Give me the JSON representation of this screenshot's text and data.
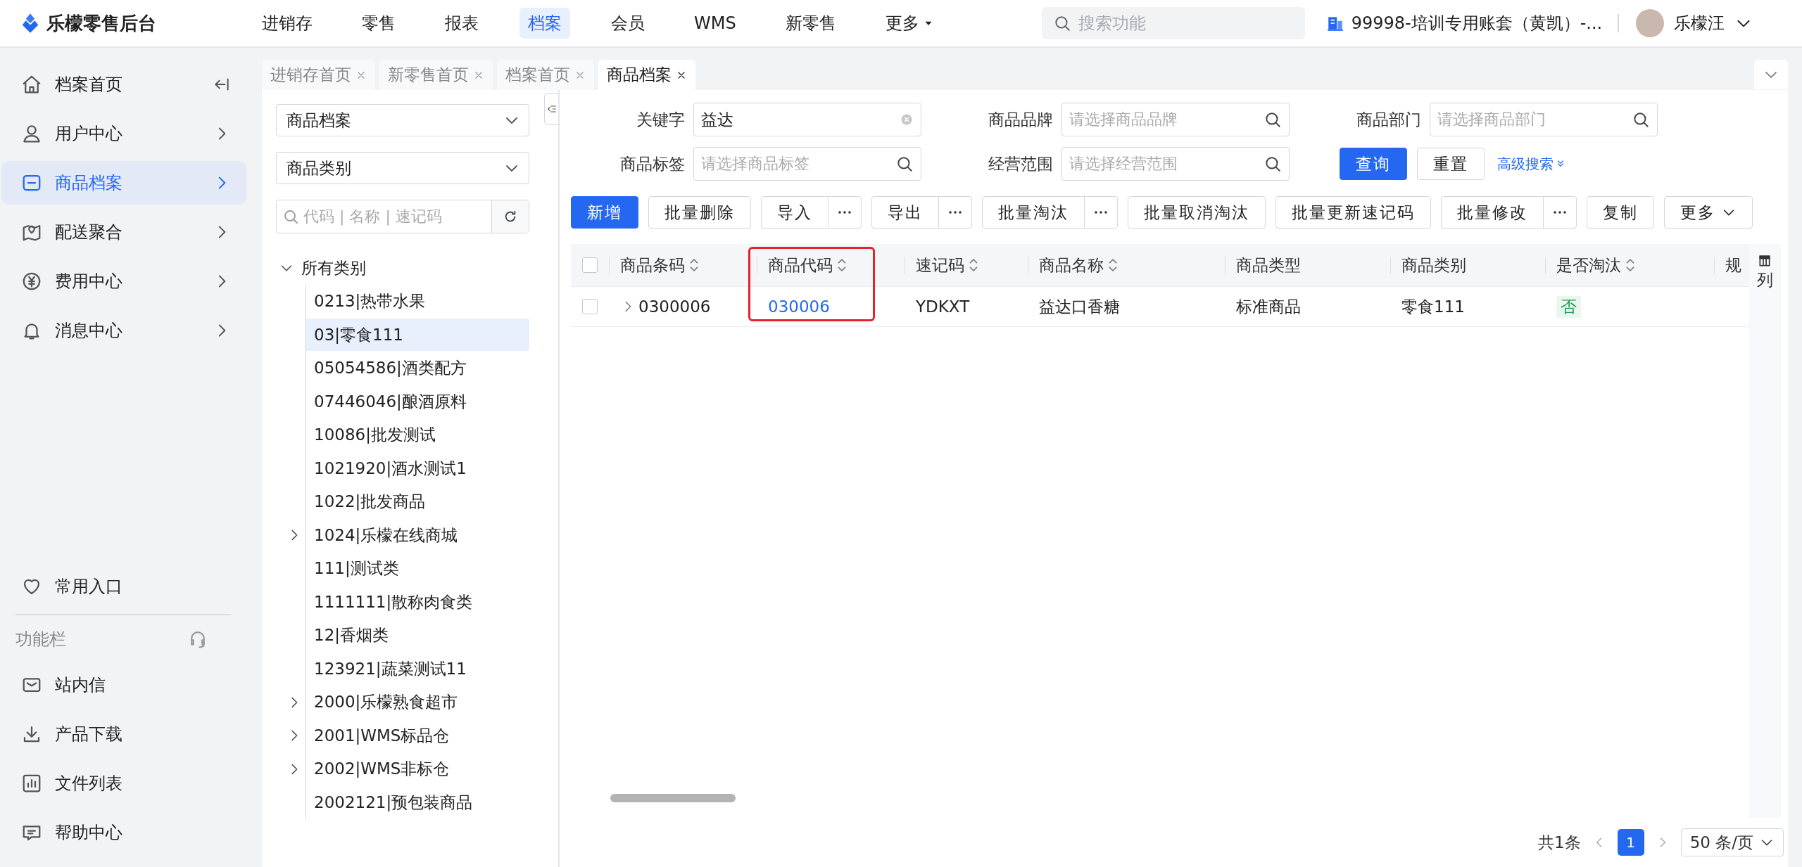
{
  "app": {
    "logo": "乐檬零售后台"
  },
  "nav": [
    {
      "label": "进销存",
      "selected": false
    },
    {
      "label": "零售",
      "selected": false
    },
    {
      "label": "报表",
      "selected": false
    },
    {
      "label": "档案",
      "selected": true
    },
    {
      "label": "会员",
      "selected": false
    },
    {
      "label": "WMS",
      "selected": false
    },
    {
      "label": "新零售",
      "selected": false
    },
    {
      "label": "更多",
      "selected": false
    }
  ],
  "search": {
    "placeholder": "搜索功能"
  },
  "account": "99998-培训专用账套（黄凯）-...",
  "user": "乐檬汪",
  "sidebar": {
    "home": "档案首页",
    "items": [
      {
        "label": "用户中心",
        "selected": false
      },
      {
        "label": "商品档案",
        "selected": true
      },
      {
        "label": "配送聚合",
        "selected": false
      },
      {
        "label": "费用中心",
        "selected": false
      },
      {
        "label": "消息中心",
        "selected": false
      }
    ],
    "favorites": "常用入口",
    "section": "功能栏",
    "tools": [
      "站内信",
      "产品下载",
      "文件列表",
      "帮助中心"
    ]
  },
  "tabs": [
    {
      "label": "进销存首页",
      "selected": false
    },
    {
      "label": "新零售首页",
      "selected": false
    },
    {
      "label": "档案首页",
      "selected": false
    },
    {
      "label": "商品档案",
      "selected": true
    }
  ],
  "category_panel": {
    "selects": [
      "商品档案",
      "商品类别"
    ],
    "search_placeholder": "代码 | 名称 | 速记码",
    "tree": {
      "label": "所有类别",
      "expanded": true,
      "children": [
        {
          "label": "0213|热带水果",
          "kind": "leaf",
          "selected": false
        },
        {
          "label": "03|零食111",
          "kind": "leaf",
          "selected": true
        },
        {
          "label": "05054586|酒类配方",
          "kind": "leaf",
          "selected": false
        },
        {
          "label": "07446046|酿酒原料",
          "kind": "leaf",
          "selected": false
        },
        {
          "label": "10086|批发测试",
          "kind": "leaf",
          "selected": false
        },
        {
          "label": "1021920|酒水测试1",
          "kind": "leaf",
          "selected": false
        },
        {
          "label": "1022|批发商品",
          "kind": "leaf",
          "selected": false
        },
        {
          "label": "1024|乐檬在线商城",
          "kind": "branch",
          "expanded": false,
          "selected": false
        },
        {
          "label": "111|测试类",
          "kind": "leaf",
          "selected": false
        },
        {
          "label": "1111111|散称肉食类",
          "kind": "leaf",
          "selected": false
        },
        {
          "label": "12|香烟类",
          "kind": "leaf",
          "selected": false
        },
        {
          "label": "123921|蔬菜测试11",
          "kind": "leaf",
          "selected": false
        },
        {
          "label": "2000|乐檬熟食超市",
          "kind": "branch",
          "expanded": false,
          "selected": false
        },
        {
          "label": "2001|WMS标品仓",
          "kind": "branch",
          "expanded": false,
          "selected": false
        },
        {
          "label": "2002|WMS非标仓",
          "kind": "branch",
          "expanded": false,
          "selected": false
        },
        {
          "label": "2002121|预包装商品",
          "kind": "leaf",
          "selected": false
        }
      ]
    }
  },
  "filters": [
    {
      "label": "关键字",
      "value": "益达",
      "kind": "text"
    },
    {
      "label": "商品品牌",
      "placeholder": "请选择商品品牌",
      "kind": "search"
    },
    {
      "label": "商品部门",
      "placeholder": "请选择商品部门",
      "kind": "search"
    },
    {
      "label": "商品标签",
      "placeholder": "请选择商品标签",
      "kind": "search"
    },
    {
      "label": "经营范围",
      "placeholder": "请选择经营范围",
      "kind": "search"
    }
  ],
  "filter_buttons": [
    {
      "label": "查询",
      "kind": "primary"
    },
    {
      "label": "重置",
      "kind": "default"
    }
  ],
  "advanced_search": "高级搜索",
  "toolbar": [
    {
      "label": "新增",
      "kind": "primary"
    },
    {
      "label": "批量删除",
      "kind": "default"
    },
    {
      "label": "导入",
      "kind": "split"
    },
    {
      "label": "导出",
      "kind": "split"
    },
    {
      "label": "批量淘汰",
      "kind": "split"
    },
    {
      "label": "批量取消淘汰",
      "kind": "default"
    },
    {
      "label": "批量更新速记码",
      "kind": "default"
    },
    {
      "label": "批量修改",
      "kind": "split"
    },
    {
      "label": "复制",
      "kind": "default"
    },
    {
      "label": "更多",
      "kind": "dropdown"
    }
  ],
  "table": {
    "header_checked": false,
    "columns": [
      {
        "label": "商品条码",
        "sortable": true,
        "kind": "text",
        "highlighted": false
      },
      {
        "label": "商品代码",
        "sortable": true,
        "kind": "link",
        "highlighted": true
      },
      {
        "label": "速记码",
        "sortable": true,
        "kind": "text",
        "highlighted": false
      },
      {
        "label": "商品名称",
        "sortable": true,
        "kind": "text",
        "highlighted": false
      },
      {
        "label": "商品类型",
        "sortable": false,
        "kind": "text",
        "highlighted": false
      },
      {
        "label": "商品类别",
        "sortable": false,
        "kind": "text",
        "highlighted": false
      },
      {
        "label": "是否淘汰",
        "sortable": true,
        "kind": "tag",
        "highlighted": false
      },
      {
        "label": "规",
        "sortable": false,
        "highlighted": false
      }
    ],
    "column_settings": "列",
    "rows": [
      {
        "checked": false,
        "expanded": false,
        "cells": [
          "0300006",
          "030006",
          "YDKXT",
          "益达口香糖",
          "标准商品",
          "零食111",
          "否"
        ]
      }
    ]
  },
  "pager": {
    "total": "共1条",
    "pages": [
      {
        "label": "1",
        "selected": true
      }
    ],
    "page_size": "50 条/页"
  }
}
